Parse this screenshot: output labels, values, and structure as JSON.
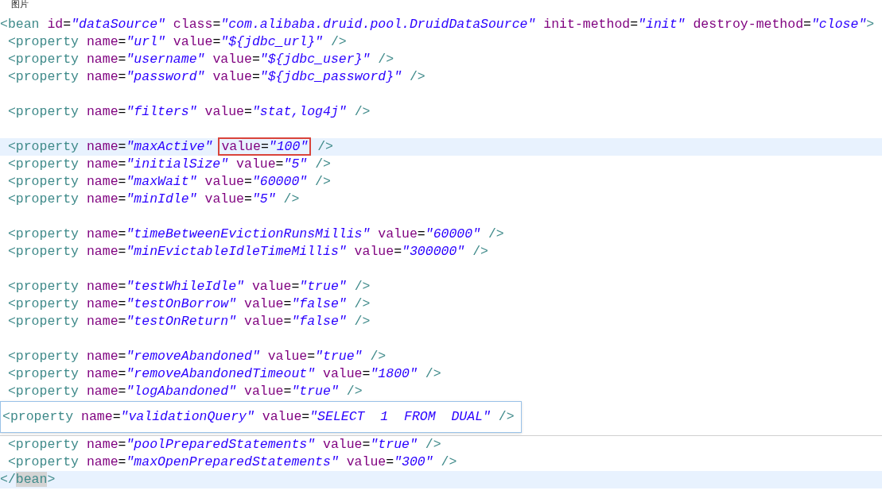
{
  "window": {
    "title": "图片"
  },
  "editor": {
    "lines": [
      {
        "kind": "code",
        "highlighted": false,
        "tokens": [
          {
            "kind": "tag",
            "text": "<bean"
          },
          {
            "kind": "attr",
            "text": " id"
          },
          {
            "kind": "eq",
            "text": "="
          },
          {
            "kind": "value",
            "text": "\"dataSource\""
          },
          {
            "kind": "attr",
            "text": " class"
          },
          {
            "kind": "eq",
            "text": "="
          },
          {
            "kind": "value",
            "text": "\"com.alibaba.druid.pool.DruidDataSource\""
          },
          {
            "kind": "attr",
            "text": " init-method"
          },
          {
            "kind": "eq",
            "text": "="
          },
          {
            "kind": "value",
            "text": "\"init\""
          },
          {
            "kind": "attr",
            "text": " destroy-method"
          },
          {
            "kind": "eq",
            "text": "="
          },
          {
            "kind": "value",
            "text": "\"close\""
          },
          {
            "kind": "tag",
            "text": ">"
          }
        ]
      },
      {
        "kind": "code",
        "highlighted": false,
        "tokens": [
          {
            "kind": "tag",
            "text": " <property"
          },
          {
            "kind": "attr",
            "text": " name"
          },
          {
            "kind": "eq",
            "text": "="
          },
          {
            "kind": "value",
            "text": "\"url\""
          },
          {
            "kind": "attr",
            "text": " value"
          },
          {
            "kind": "eq",
            "text": "="
          },
          {
            "kind": "value",
            "text": "\"${jdbc_url}\""
          },
          {
            "kind": "tag",
            "text": " />"
          }
        ]
      },
      {
        "kind": "code",
        "highlighted": false,
        "tokens": [
          {
            "kind": "tag",
            "text": " <property"
          },
          {
            "kind": "attr",
            "text": " name"
          },
          {
            "kind": "eq",
            "text": "="
          },
          {
            "kind": "value",
            "text": "\"username\""
          },
          {
            "kind": "attr",
            "text": " value"
          },
          {
            "kind": "eq",
            "text": "="
          },
          {
            "kind": "value",
            "text": "\"${jdbc_user}\""
          },
          {
            "kind": "tag",
            "text": " />"
          }
        ]
      },
      {
        "kind": "code",
        "highlighted": false,
        "tokens": [
          {
            "kind": "tag",
            "text": " <property"
          },
          {
            "kind": "attr",
            "text": " name"
          },
          {
            "kind": "eq",
            "text": "="
          },
          {
            "kind": "value",
            "text": "\"password\""
          },
          {
            "kind": "attr",
            "text": " value"
          },
          {
            "kind": "eq",
            "text": "="
          },
          {
            "kind": "value",
            "text": "\"${jdbc_password}\""
          },
          {
            "kind": "tag",
            "text": " />"
          }
        ]
      },
      {
        "kind": "blank"
      },
      {
        "kind": "code",
        "highlighted": false,
        "tokens": [
          {
            "kind": "tag",
            "text": " <property"
          },
          {
            "kind": "attr",
            "text": " name"
          },
          {
            "kind": "eq",
            "text": "="
          },
          {
            "kind": "value",
            "text": "\"filters\""
          },
          {
            "kind": "attr",
            "text": " value"
          },
          {
            "kind": "eq",
            "text": "="
          },
          {
            "kind": "value",
            "text": "\"stat,log4j\""
          },
          {
            "kind": "tag",
            "text": " />"
          }
        ]
      },
      {
        "kind": "blank"
      },
      {
        "kind": "code",
        "highlighted": true,
        "tokens": [
          {
            "kind": "tag",
            "text": " <property"
          },
          {
            "kind": "attr",
            "text": " name"
          },
          {
            "kind": "eq",
            "text": "="
          },
          {
            "kind": "value",
            "text": "\"maxActive\""
          },
          {
            "kind": "group",
            "boxed": true,
            "tokens": [
              {
                "kind": "attr",
                "text": "value"
              },
              {
                "kind": "eq",
                "text": "="
              },
              {
                "kind": "value",
                "text": "\"100\""
              }
            ]
          },
          {
            "kind": "tag",
            "text": " />"
          }
        ]
      },
      {
        "kind": "code",
        "highlighted": false,
        "tokens": [
          {
            "kind": "tag",
            "text": " <property"
          },
          {
            "kind": "attr",
            "text": " name"
          },
          {
            "kind": "eq",
            "text": "="
          },
          {
            "kind": "value",
            "text": "\"initialSize\""
          },
          {
            "kind": "attr",
            "text": " value"
          },
          {
            "kind": "eq",
            "text": "="
          },
          {
            "kind": "value",
            "text": "\"5\""
          },
          {
            "kind": "tag",
            "text": " />"
          }
        ]
      },
      {
        "kind": "code",
        "highlighted": false,
        "tokens": [
          {
            "kind": "tag",
            "text": " <property"
          },
          {
            "kind": "attr",
            "text": " name"
          },
          {
            "kind": "eq",
            "text": "="
          },
          {
            "kind": "value",
            "text": "\"maxWait\""
          },
          {
            "kind": "attr",
            "text": " value"
          },
          {
            "kind": "eq",
            "text": "="
          },
          {
            "kind": "value",
            "text": "\"60000\""
          },
          {
            "kind": "tag",
            "text": " />"
          }
        ]
      },
      {
        "kind": "code",
        "highlighted": false,
        "tokens": [
          {
            "kind": "tag",
            "text": " <property"
          },
          {
            "kind": "attr",
            "text": " name"
          },
          {
            "kind": "eq",
            "text": "="
          },
          {
            "kind": "value",
            "text": "\"minIdle\""
          },
          {
            "kind": "attr",
            "text": " value"
          },
          {
            "kind": "eq",
            "text": "="
          },
          {
            "kind": "value",
            "text": "\"5\""
          },
          {
            "kind": "tag",
            "text": " />"
          }
        ]
      },
      {
        "kind": "blank"
      },
      {
        "kind": "code",
        "highlighted": false,
        "tokens": [
          {
            "kind": "tag",
            "text": " <property"
          },
          {
            "kind": "attr",
            "text": " name"
          },
          {
            "kind": "eq",
            "text": "="
          },
          {
            "kind": "value",
            "text": "\"timeBetweenEvictionRunsMillis\""
          },
          {
            "kind": "attr",
            "text": " value"
          },
          {
            "kind": "eq",
            "text": "="
          },
          {
            "kind": "value",
            "text": "\"60000\""
          },
          {
            "kind": "tag",
            "text": " />"
          }
        ]
      },
      {
        "kind": "code",
        "highlighted": false,
        "tokens": [
          {
            "kind": "tag",
            "text": " <property"
          },
          {
            "kind": "attr",
            "text": " name"
          },
          {
            "kind": "eq",
            "text": "="
          },
          {
            "kind": "value",
            "text": "\"minEvictableIdleTimeMillis\""
          },
          {
            "kind": "attr",
            "text": " value"
          },
          {
            "kind": "eq",
            "text": "="
          },
          {
            "kind": "value",
            "text": "\"300000\""
          },
          {
            "kind": "tag",
            "text": " />"
          }
        ]
      },
      {
        "kind": "blank"
      },
      {
        "kind": "code",
        "highlighted": false,
        "tokens": [
          {
            "kind": "tag",
            "text": " <property"
          },
          {
            "kind": "attr",
            "text": " name"
          },
          {
            "kind": "eq",
            "text": "="
          },
          {
            "kind": "value",
            "text": "\"testWhileIdle\""
          },
          {
            "kind": "attr",
            "text": " value"
          },
          {
            "kind": "eq",
            "text": "="
          },
          {
            "kind": "value",
            "text": "\"true\""
          },
          {
            "kind": "tag",
            "text": " />"
          }
        ]
      },
      {
        "kind": "code",
        "highlighted": false,
        "tokens": [
          {
            "kind": "tag",
            "text": " <property"
          },
          {
            "kind": "attr",
            "text": " name"
          },
          {
            "kind": "eq",
            "text": "="
          },
          {
            "kind": "value",
            "text": "\"testOnBorrow\""
          },
          {
            "kind": "attr",
            "text": " value"
          },
          {
            "kind": "eq",
            "text": "="
          },
          {
            "kind": "value",
            "text": "\"false\""
          },
          {
            "kind": "tag",
            "text": " />"
          }
        ]
      },
      {
        "kind": "code",
        "highlighted": false,
        "tokens": [
          {
            "kind": "tag",
            "text": " <property"
          },
          {
            "kind": "attr",
            "text": " name"
          },
          {
            "kind": "eq",
            "text": "="
          },
          {
            "kind": "value",
            "text": "\"testOnReturn\""
          },
          {
            "kind": "attr",
            "text": " value"
          },
          {
            "kind": "eq",
            "text": "="
          },
          {
            "kind": "value",
            "text": "\"false\""
          },
          {
            "kind": "tag",
            "text": " />"
          }
        ]
      },
      {
        "kind": "blank"
      },
      {
        "kind": "code",
        "highlighted": false,
        "tokens": [
          {
            "kind": "tag",
            "text": " <property"
          },
          {
            "kind": "attr",
            "text": " name"
          },
          {
            "kind": "eq",
            "text": "="
          },
          {
            "kind": "value",
            "text": "\"removeAbandoned\""
          },
          {
            "kind": "attr",
            "text": " value"
          },
          {
            "kind": "eq",
            "text": "="
          },
          {
            "kind": "value",
            "text": "\"true\""
          },
          {
            "kind": "tag",
            "text": " />"
          }
        ]
      },
      {
        "kind": "code",
        "highlighted": false,
        "tokens": [
          {
            "kind": "tag",
            "text": " <property"
          },
          {
            "kind": "attr",
            "text": " name"
          },
          {
            "kind": "eq",
            "text": "="
          },
          {
            "kind": "value",
            "text": "\"removeAbandonedTimeout\""
          },
          {
            "kind": "attr",
            "text": " value"
          },
          {
            "kind": "eq",
            "text": "="
          },
          {
            "kind": "value",
            "text": "\"1800\""
          },
          {
            "kind": "tag",
            "text": " />"
          }
        ]
      },
      {
        "kind": "code",
        "highlighted": false,
        "tokens": [
          {
            "kind": "tag",
            "text": " <property"
          },
          {
            "kind": "attr",
            "text": " name"
          },
          {
            "kind": "eq",
            "text": "="
          },
          {
            "kind": "value",
            "text": "\"logAbandoned\""
          },
          {
            "kind": "attr",
            "text": " value"
          },
          {
            "kind": "eq",
            "text": "="
          },
          {
            "kind": "value",
            "text": "\"true\""
          },
          {
            "kind": "tag",
            "text": " />"
          }
        ]
      }
    ],
    "popup": {
      "tokens": [
        {
          "kind": "tag",
          "text": "<property"
        },
        {
          "kind": "attr",
          "text": " name"
        },
        {
          "kind": "eq",
          "text": "="
        },
        {
          "kind": "value",
          "text": "\"validationQuery\""
        },
        {
          "kind": "attr",
          "text": " value"
        },
        {
          "kind": "eq",
          "text": "="
        },
        {
          "kind": "value",
          "text": "\"SELECT  1  FROM  DUAL\""
        },
        {
          "kind": "tag",
          "text": " />"
        }
      ]
    },
    "lines_after": [
      {
        "kind": "code",
        "highlighted": false,
        "tokens": [
          {
            "kind": "tag",
            "text": " <property"
          },
          {
            "kind": "attr",
            "text": " name"
          },
          {
            "kind": "eq",
            "text": "="
          },
          {
            "kind": "value",
            "text": "\"poolPreparedStatements\""
          },
          {
            "kind": "attr",
            "text": " value"
          },
          {
            "kind": "eq",
            "text": "="
          },
          {
            "kind": "value",
            "text": "\"true\""
          },
          {
            "kind": "tag",
            "text": " />"
          }
        ]
      },
      {
        "kind": "code",
        "highlighted": false,
        "tokens": [
          {
            "kind": "tag",
            "text": " <property"
          },
          {
            "kind": "attr",
            "text": " name"
          },
          {
            "kind": "eq",
            "text": "="
          },
          {
            "kind": "value",
            "text": "\"maxOpenPreparedStatements\""
          },
          {
            "kind": "attr",
            "text": " value"
          },
          {
            "kind": "eq",
            "text": "="
          },
          {
            "kind": "value",
            "text": "\"300\""
          },
          {
            "kind": "tag",
            "text": " />"
          }
        ]
      },
      {
        "kind": "code",
        "highlighted": true,
        "tokens": [
          {
            "kind": "tag",
            "text": "</"
          },
          {
            "kind": "tag",
            "text": "bean",
            "matched": true
          },
          {
            "kind": "tag",
            "text": ">"
          }
        ]
      }
    ]
  }
}
